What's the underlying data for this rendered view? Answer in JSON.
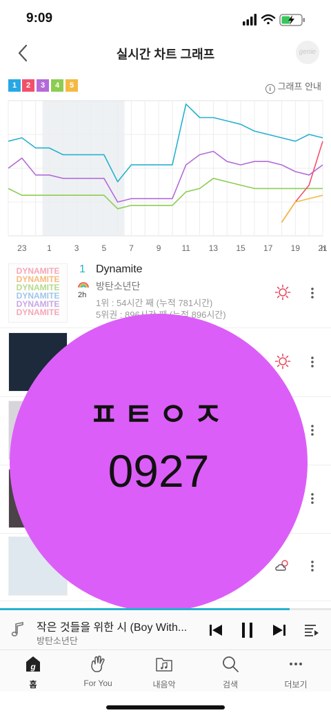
{
  "status_bar": {
    "time": "9:09"
  },
  "header": {
    "title": "실시간 차트 그래프",
    "logo_text": "genie"
  },
  "rank_legend": [
    {
      "label": "1",
      "color": "#28a7e6"
    },
    {
      "label": "2",
      "color": "#f2506a"
    },
    {
      "label": "3",
      "color": "#b46ad8"
    },
    {
      "label": "4",
      "color": "#8ccd50"
    },
    {
      "label": "5",
      "color": "#f5b942"
    }
  ],
  "graph_guide": "그래프 안내",
  "chart_data": {
    "type": "line",
    "x_ticks": [
      "23",
      "1",
      "3",
      "5",
      "7",
      "9",
      "11",
      "13",
      "15",
      "17",
      "19",
      "21"
    ],
    "x_unit": "h",
    "x": [
      22,
      23,
      0,
      1,
      2,
      3,
      4,
      5,
      6,
      7,
      8,
      9,
      10,
      11,
      12,
      13,
      14,
      15,
      16,
      17,
      18,
      19,
      20,
      21
    ],
    "grid": true,
    "shaded_hours": [
      1,
      6
    ],
    "series": [
      {
        "color": "#25b1cf",
        "values": [
          1.2,
          1.1,
          1.4,
          1.4,
          1.6,
          1.6,
          1.6,
          1.6,
          2.4,
          1.9,
          1.9,
          1.9,
          1.9,
          0.1,
          0.5,
          0.5,
          0.6,
          0.7,
          0.9,
          1.0,
          1.1,
          1.2,
          1.0,
          1.1
        ]
      },
      {
        "color": "#b46ad8",
        "values": [
          2.0,
          1.7,
          2.2,
          2.2,
          2.3,
          2.3,
          2.3,
          2.3,
          3.0,
          2.9,
          2.9,
          2.9,
          2.9,
          1.9,
          1.6,
          1.5,
          1.8,
          1.9,
          1.8,
          1.8,
          1.9,
          2.1,
          2.2,
          1.9
        ]
      },
      {
        "color": "#8ccd50",
        "values": [
          2.6,
          2.8,
          2.8,
          2.8,
          2.8,
          2.8,
          2.8,
          2.8,
          3.2,
          3.1,
          3.1,
          3.1,
          3.1,
          2.7,
          2.6,
          2.3,
          2.4,
          2.5,
          2.6,
          2.6,
          2.6,
          2.6,
          2.6,
          2.6
        ]
      },
      {
        "color": "#f2506a",
        "start_index": 20,
        "values": [
          3.6,
          3.0,
          2.5,
          1.2
        ]
      },
      {
        "color": "#f5b942",
        "start_index": 20,
        "values": [
          3.6,
          3.0,
          2.9,
          2.8
        ]
      }
    ]
  },
  "songs": [
    {
      "rank": "1",
      "hours": "2h",
      "title": "Dynamite",
      "artist": "방탄소년단",
      "stat1": "1위 : 54시간 째 (누적 781시간)",
      "stat2": "5위권 : 896시간 째 (누적 896시간)",
      "weather": "sun-icon",
      "art_text": "DYNAMITE"
    },
    {
      "rank": "",
      "hours": "",
      "title": "",
      "artist": "",
      "stat1": "",
      "stat2": "",
      "weather": "sun-icon"
    },
    {
      "rank": "",
      "hours": "",
      "title": "",
      "artist": "",
      "stat1": "",
      "stat2": "",
      "weather": ""
    },
    {
      "rank": "",
      "hours": "",
      "title": "",
      "artist": "",
      "stat1": "",
      "stat2": "",
      "weather": ""
    },
    {
      "rank": "",
      "hours": "",
      "title": "",
      "artist": "",
      "stat1": "",
      "stat2": "",
      "weather": "cloud-sun-icon"
    }
  ],
  "overlay": {
    "line1": "ㅍㅌㅇㅈ",
    "line2": "0927"
  },
  "player": {
    "title": "작은 것들을 위한 시 (Boy With...",
    "artist": "방탄소년단",
    "progress": 0.875
  },
  "tabs": [
    {
      "label": "홈",
      "icon": "home-g-icon",
      "active": true
    },
    {
      "label": "For You",
      "icon": "hand-icon",
      "active": false
    },
    {
      "label": "내음악",
      "icon": "music-folder-icon",
      "active": false
    },
    {
      "label": "검색",
      "icon": "search-icon",
      "active": false
    },
    {
      "label": "더보기",
      "icon": "more-dots-icon",
      "active": false
    }
  ]
}
